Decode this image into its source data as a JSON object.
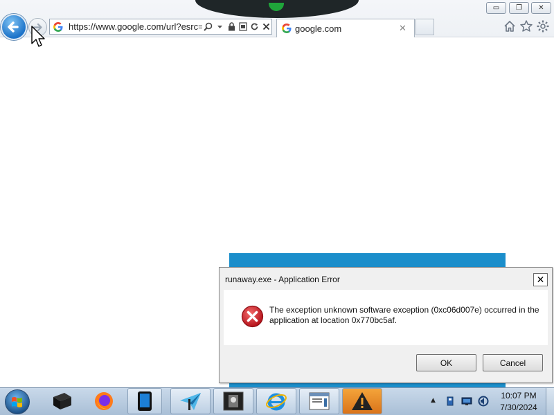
{
  "browser": {
    "address_url": "https://www.google.com/url?esrc=sl",
    "tab_title": "google.com",
    "tab_close_glyph": "✕",
    "icons": {
      "back": "back-arrow-icon",
      "forward": "forward-arrow-icon",
      "favicon": "google-g-icon",
      "search": "search-icon",
      "dropdown": "chevron-down-icon",
      "lock": "lock-icon",
      "compat": "compatibility-view-icon",
      "refresh": "refresh-icon",
      "stop": "close-icon",
      "home": "home-icon",
      "favorites": "star-icon",
      "tools": "gear-icon"
    },
    "window_buttons": {
      "minimize": "▭",
      "restore": "❐",
      "close": "✕"
    }
  },
  "dialog": {
    "title": "runaway.exe - Application Error",
    "close_glyph": "✕",
    "message": "The exception unknown software exception (0xc06d007e) occurred in the application at location 0x770bc5af.",
    "icon": "error-icon",
    "ok_label": "OK",
    "cancel_label": "Cancel"
  },
  "taskbar": {
    "items": [
      "start-orb",
      "black-box-app",
      "firefox",
      "tablet-app",
      "paper-plane-app",
      "terminal-app",
      "internet-explorer",
      "document-app",
      "warning-app"
    ],
    "tray_up_glyph": "▲",
    "clock_time": "10:07 PM",
    "clock_date": "7/30/2024"
  },
  "colors": {
    "accent_blue": "#1b8ecb",
    "error_red": "#c8181e",
    "taskbar": "#b9cde2"
  }
}
